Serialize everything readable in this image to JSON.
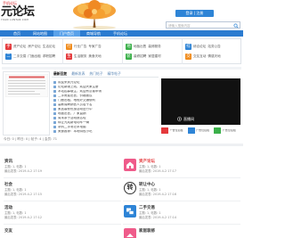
{
  "theme": {
    "primary": "#2b7bd0",
    "nav_active": "#5aa2ea",
    "login_button": "#2e84d6"
  },
  "header": {
    "mobile_link": "手机论坛",
    "logo_text": "元论坛",
    "logo_sub": "YUAN LUNTAN.COM",
    "login_button": "登录 | 注册",
    "search_placeholder": "请输入搜索内容"
  },
  "nav": [
    "首页",
    "网站地图",
    "门户首页",
    "商城导航",
    "手机论坛"
  ],
  "quick_links": [
    {
      "icon": "手",
      "color": "#e4393c",
      "links": [
        "资产论坛",
        "房产论坛",
        "生活论坛"
      ]
    },
    {
      "icon": "二",
      "color": "#2e84d6",
      "links": [
        "二手交易",
        "门面出租",
        "求职招聘"
      ]
    },
    {
      "icon": "行",
      "color": "#f08c1e",
      "links": [
        "行业广告",
        "专家广告"
      ]
    },
    {
      "icon": "生",
      "color": "#e4393c",
      "links": [
        "生活服务",
        "美食天地"
      ]
    },
    {
      "icon": "地",
      "color": "#3bb04a",
      "links": [
        "地板出售",
        "装修服务"
      ]
    },
    {
      "icon": "装",
      "color": "#3bb04a",
      "links": [
        "装修招聘",
        "家居建材"
      ]
    },
    {
      "icon": "综",
      "color": "#2e84d6",
      "links": [
        "综合论坛",
        "站务公告"
      ]
    },
    {
      "icon": "交",
      "color": "#f08c1e",
      "links": [
        "交友互动",
        "情感天地"
      ]
    }
  ],
  "main_tabs": [
    "最新回复",
    "最新发表",
    "热门帖子",
    "精华帖子"
  ],
  "posts": [
    "欢迎来到元论坛",
    "论坛新版上线，欢迎大家注册",
    "本站招募版主，欢迎有意者申请",
    "二手房屋出售，价格面议",
    "门面出租，地段好交通便利",
    "高薪诚聘销售人员若干名",
    "家居装修优惠活动进行中",
    "地板出售，厂家直销",
    "周末亲子活动报名啦",
    "转让九成新电动车一辆",
    "求购二手笔记本电脑",
    "美食推荐：本地特色小吃"
  ],
  "media": {
    "caption": "直播间"
  },
  "ads": [
    {
      "label": "广告位招租",
      "color": "#e4393c"
    },
    {
      "label": "广告位招租",
      "color": "#2e84d6"
    },
    {
      "label": "广告位招租",
      "color": "#3bb04a"
    }
  ],
  "stats": "今日: 0 | 昨日: 0 | 帖子: 4 | 会员: 71",
  "forums_left": [
    {
      "name": "资讯",
      "title_color": "#333333",
      "stats": "主题: 1, 帖数: 1",
      "last_post": "最后发表: 2019-4-2 17:19"
    },
    {
      "name": "社会",
      "title_color": "#333333",
      "stats": "主题: 1, 帖数: 1",
      "last_post": "最后发表: 2019-4-2 17:15"
    },
    {
      "name": "活动",
      "title_color": "#333333",
      "stats": "主题: 1, 帖数: 1",
      "last_post": "最后发表: 2019-4-2 17:12"
    },
    {
      "name": "交友",
      "title_color": "#333333"
    }
  ],
  "forums_right": [
    {
      "name": "资产论坛",
      "title_color": "#e4393c",
      "icon": "house-icon",
      "icon_color": "#ef5b8a",
      "stats": "主题: 1, 帖数: 1",
      "last_post": "最后发表: 2019-4-2 17:17"
    },
    {
      "name": "转让中心",
      "title_color": "#333333",
      "icon_text": "转",
      "stats": "主题: 1, 帖数: 1",
      "last_post": "最后发表: 2019-4-2 17:16"
    },
    {
      "name": "二手交易",
      "title_color": "#333333",
      "icon": "cards-icon",
      "icon_color": "#2e84d6",
      "stats": "主题: 1, 帖数: 1",
      "last_post": "最后发表: 2019-4-2 17:14"
    },
    {
      "name": "家居装修",
      "title_color": "#333333",
      "icon": "home-decor-icon",
      "icon_color": "#ef5b8a"
    }
  ]
}
